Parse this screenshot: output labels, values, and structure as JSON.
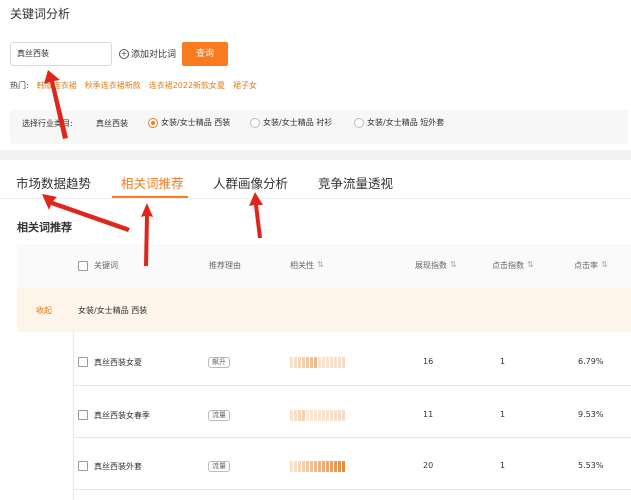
{
  "page": {
    "title": "关键词分析"
  },
  "search": {
    "value": "真丝西装",
    "add_compare_label": "添加对比词",
    "query_label": "查询"
  },
  "hot": {
    "label": "热门:",
    "items": [
      "韩版连衣裙",
      "秋季连衣裙新款",
      "连衣裙2022新款女夏",
      "裙子女"
    ]
  },
  "industry": {
    "label": "选择行业类目:",
    "keyword": "真丝西装",
    "options": [
      {
        "label": "女装/女士精品 西装",
        "checked": true
      },
      {
        "label": "女装/女士精品 衬衫",
        "checked": false
      },
      {
        "label": "女装/女士精品 短外套",
        "checked": false
      }
    ]
  },
  "tabs": [
    {
      "label": "市场数据趋势",
      "active": false
    },
    {
      "label": "相关词推荐",
      "active": true
    },
    {
      "label": "人群画像分析",
      "active": false
    },
    {
      "label": "竞争流量透视",
      "active": false
    }
  ],
  "section": {
    "title": "相关词推荐"
  },
  "table": {
    "columns": [
      "关键词",
      "推荐理由",
      "相关性",
      "展现指数",
      "点击指数",
      "点击率"
    ],
    "group": {
      "collapse_label": "收起",
      "name": "女装/女士精品 西装"
    },
    "rows": [
      {
        "keyword": "真丝西装女夏",
        "reason": "飙升",
        "relevance": 0.5,
        "impressions": "16",
        "clicks": "1",
        "ctr": "6.79%"
      },
      {
        "keyword": "真丝西装女春季",
        "reason": "流量",
        "relevance": 0.3,
        "impressions": "11",
        "clicks": "1",
        "ctr": "9.53%"
      },
      {
        "keyword": "真丝西装外套",
        "reason": "流量",
        "relevance": 1.0,
        "impressions": "20",
        "clicks": "1",
        "ctr": "5.53%"
      }
    ]
  },
  "colors": {
    "accent": "#f97a1f",
    "arrow": "#e0251b"
  }
}
